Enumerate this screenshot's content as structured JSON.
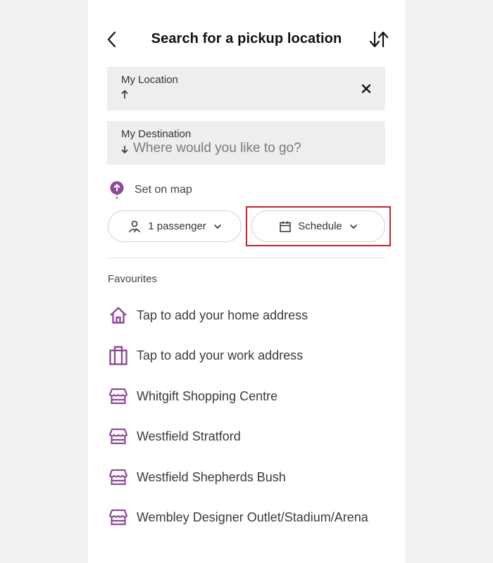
{
  "header": {
    "title": "Search for a pickup location",
    "back_icon": "chevron-left-icon",
    "swap_icon": "swap-vertical-icon"
  },
  "location_field": {
    "label": "My Location",
    "value": "",
    "direction_icon": "arrow-up-icon",
    "clear_icon": "close-icon"
  },
  "destination_field": {
    "label": "My Destination",
    "placeholder": "Where would you like to go?",
    "value": "",
    "direction_icon": "arrow-down-icon"
  },
  "set_on_map": {
    "label": "Set on map",
    "icon": "map-pin-icon"
  },
  "options": {
    "passenger": {
      "label": "1 passenger",
      "icon": "person-icon"
    },
    "schedule": {
      "label": "Schedule",
      "icon": "calendar-icon",
      "highlighted": true
    }
  },
  "favourites": {
    "title": "Favourites",
    "items": [
      {
        "label": "Tap to add your home address",
        "icon": "home-icon"
      },
      {
        "label": "Tap to add your work address",
        "icon": "briefcase-icon"
      },
      {
        "label": "Whitgift Shopping Centre",
        "icon": "store-icon"
      },
      {
        "label": "Westfield Stratford",
        "icon": "store-icon"
      },
      {
        "label": "Westfield Shepherds Bush",
        "icon": "store-icon"
      },
      {
        "label": "Wembley Designer Outlet/Stadium/Arena",
        "icon": "store-icon"
      }
    ]
  },
  "colors": {
    "accent": "#8e4a98",
    "highlight_border": "#c8242e",
    "field_bg": "#eeeeee",
    "page_bg": "#f3f3f3"
  }
}
